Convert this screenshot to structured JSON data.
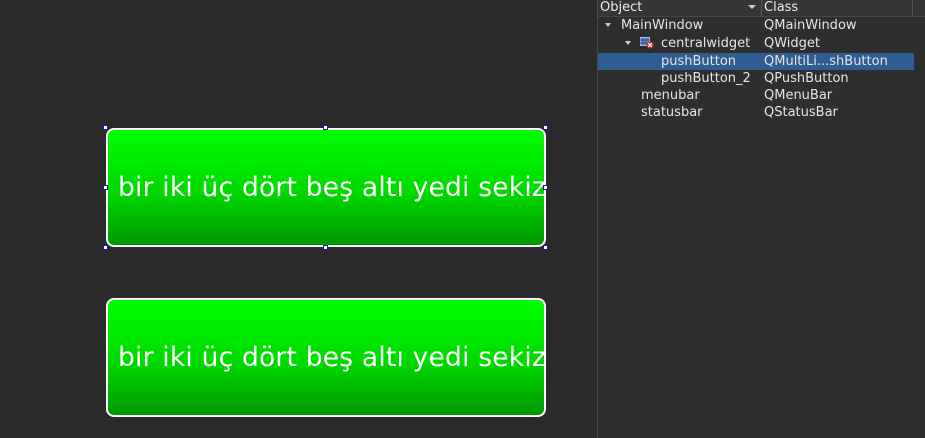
{
  "canvas": {
    "buttons": [
      {
        "text": "bir iki üç dört beş altı yedi sekiz"
      },
      {
        "text": "bir iki üç dört beş altı yedi sekiz"
      }
    ]
  },
  "inspector": {
    "header": {
      "object": "Object",
      "class": "Class"
    },
    "rows": [
      {
        "name": "MainWindow",
        "class": "QMainWindow",
        "expanded": true
      },
      {
        "name": "centralwidget",
        "class": "QWidget",
        "expanded": true,
        "icon": "layout-broken-icon"
      },
      {
        "name": "pushButton",
        "class": "QMultiLi...shButton",
        "selected": true
      },
      {
        "name": "pushButton_2",
        "class": "QPushButton"
      },
      {
        "name": "menubar",
        "class": "QMenuBar"
      },
      {
        "name": "statusbar",
        "class": "QStatusBar"
      }
    ]
  },
  "colors": {
    "button_green_top": "#00ff00",
    "button_green_bottom": "#009800",
    "selection": "#2d5d91",
    "canvas_bg": "#2b2b2b"
  }
}
